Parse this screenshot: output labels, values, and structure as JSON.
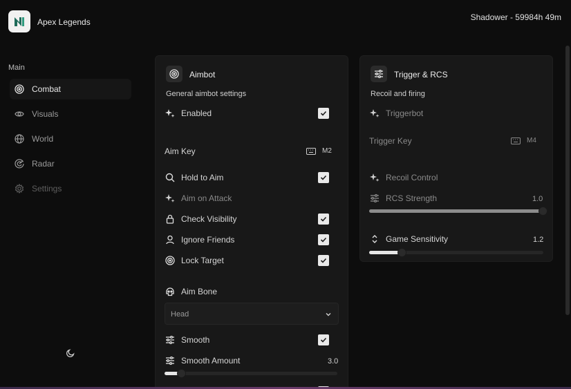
{
  "app": {
    "title": "Apex Legends",
    "logo_icon": "menu-logo-icon"
  },
  "user": {
    "info": "Shadower - 59984h 49m"
  },
  "sidebar": {
    "heading": "Main",
    "items": [
      {
        "label": "Combat",
        "icon": "target-icon",
        "active": true
      },
      {
        "label": "Visuals",
        "icon": "eye-icon"
      },
      {
        "label": "World",
        "icon": "globe-icon"
      },
      {
        "label": "Radar",
        "icon": "radar-icon"
      },
      {
        "label": "Settings",
        "icon": "gear-icon",
        "disabled": true
      }
    ]
  },
  "aimbot": {
    "title": "Aimbot",
    "subtitle": "General aimbot settings",
    "enabled": {
      "label": "Enabled",
      "checked": true
    },
    "aim_key": {
      "label": "Aim Key",
      "value": "M2"
    },
    "hold_to_aim": {
      "label": "Hold to Aim",
      "checked": true
    },
    "aim_on_attack": {
      "label": "Aim on Attack",
      "checked": false
    },
    "check_visibility": {
      "label": "Check Visibility",
      "checked": true
    },
    "ignore_friends": {
      "label": "Ignore Friends",
      "checked": true
    },
    "lock_target": {
      "label": "Lock Target",
      "checked": true
    },
    "aim_bone": {
      "label": "Aim Bone",
      "selected": "Head"
    },
    "smooth": {
      "label": "Smooth",
      "checked": true
    },
    "smooth_amount": {
      "label": "Smooth Amount",
      "value": "3.0",
      "fraction": 0.1
    }
  },
  "trigger": {
    "title": "Trigger & RCS",
    "subtitle": "Recoil and firing",
    "triggerbot": {
      "label": "Triggerbot",
      "checked": false
    },
    "trigger_key": {
      "label": "Trigger Key",
      "value": "M4"
    },
    "recoil_control": {
      "label": "Recoil Control",
      "checked": false
    },
    "rcs_strength": {
      "label": "RCS Strength",
      "value": "1.0",
      "fraction": 1.0
    },
    "game_sensitivity": {
      "label": "Game Sensitivity",
      "value": "1.2",
      "fraction": 0.19
    }
  },
  "colors": {
    "background": "#0d0d0d",
    "card": "#181818",
    "accent": "#e9e9e9",
    "muted": "#8a8a8a"
  }
}
